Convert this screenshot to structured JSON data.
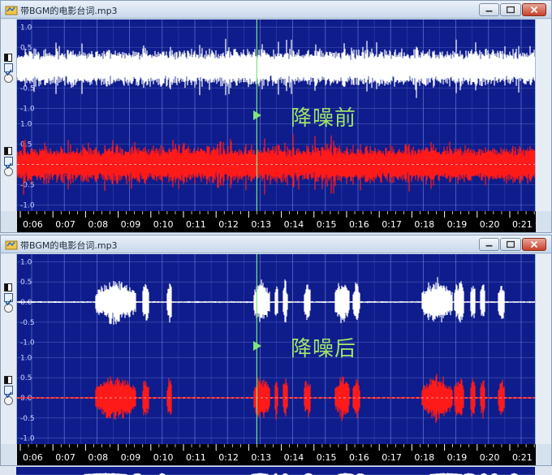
{
  "windows": [
    {
      "title": "带BGM的电影台词.mp3",
      "annotation": "降噪前",
      "tracks": [
        {
          "color": "#ffffff",
          "profile": "noisy"
        },
        {
          "color": "#ff1a1a",
          "profile": "noisy"
        }
      ]
    },
    {
      "title": "带BGM的电影台词.mp3",
      "annotation": "降噪后",
      "tracks": [
        {
          "color": "#ffffff",
          "profile": "clean"
        },
        {
          "color": "#ff1a1a",
          "profile": "clean"
        }
      ]
    }
  ],
  "amplitude_labels": [
    "1.0",
    "0.5",
    "0.0",
    "-0.5",
    "-1.0"
  ],
  "time_labels": [
    "0:06",
    "0:07",
    "0:08",
    "0:09",
    "0:10",
    "0:11",
    "0:12",
    "0:13",
    "0:14",
    "0:15",
    "0:16",
    "0:17",
    "0:18",
    "0:19",
    "0:20",
    "0:21"
  ],
  "playhead_time": "0:12.9",
  "colors": {
    "plot_bg": "#0f1d8c",
    "grid": "#6f7fd8",
    "annotation": "#9ee26a",
    "playhead": "#7be67a"
  },
  "icons": [
    "app-icon",
    "minimize-icon",
    "maximize-icon",
    "close-icon",
    "play-icon"
  ]
}
